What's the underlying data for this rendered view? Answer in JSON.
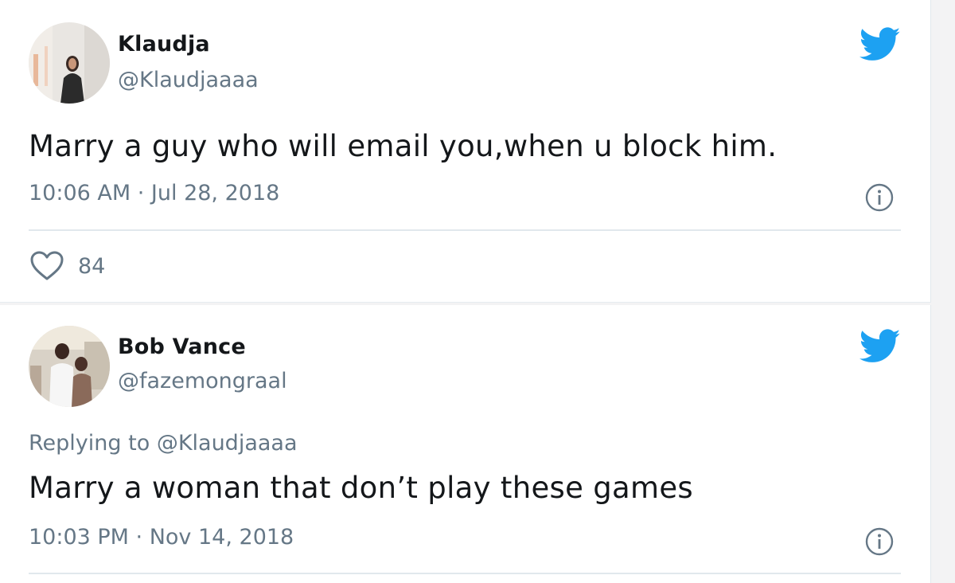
{
  "tweets": [
    {
      "display_name": "Klaudja",
      "handle": "@Klaudjaaaa",
      "avatar": "avatar-woman-photo",
      "text": "Marry a guy who will email you,when u block him.",
      "timestamp": "10:06 AM · Jul 28, 2018",
      "likes": "84",
      "icons": [
        "twitter-bird-icon",
        "info-icon",
        "heart-icon"
      ]
    },
    {
      "display_name": "Bob Vance",
      "handle": "@fazemongraal",
      "avatar": "avatar-couple-photo",
      "replying_prefix": "Replying to ",
      "replying_to": "@Klaudjaaaa",
      "text": "Marry a woman that don’t play these games",
      "timestamp": "10:03 PM · Nov 14, 2018",
      "icons": [
        "twitter-bird-icon",
        "info-icon"
      ]
    }
  ],
  "colors": {
    "text_primary": "#14171a",
    "text_secondary": "#657786",
    "twitter_blue": "#1da1f2",
    "divider": "#e1e8ed"
  }
}
